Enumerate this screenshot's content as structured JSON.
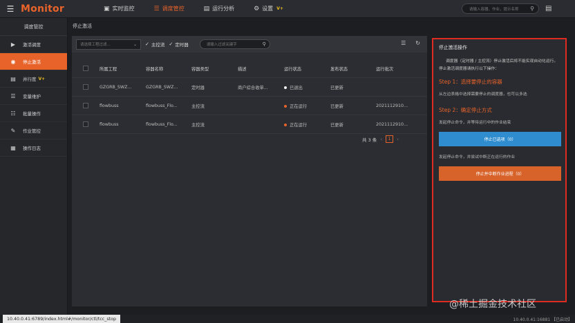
{
  "app": {
    "brand": "Monitor"
  },
  "topnav": [
    {
      "icon": "monitor-icon",
      "label": "实时监控",
      "active": false
    },
    {
      "icon": "schedule-icon",
      "label": "调度管控",
      "active": true
    },
    {
      "icon": "analysis-icon",
      "label": "运行分析",
      "active": false
    },
    {
      "icon": "gear-icon",
      "label": "设置",
      "badge": "V+",
      "active": false
    }
  ],
  "top_search": {
    "placeholder": "请输入容器，作业，提示名称"
  },
  "sidebar": {
    "header": "调度管控",
    "items": [
      {
        "icon": "play-icon",
        "label": "激活调度"
      },
      {
        "icon": "stop-icon",
        "label": "停止激活",
        "active": true
      },
      {
        "icon": "parallel-icon",
        "label": "并行度",
        "badge": "V+"
      },
      {
        "icon": "variable-icon",
        "label": "变量维护"
      },
      {
        "icon": "batch-icon",
        "label": "批量操作"
      },
      {
        "icon": "job-icon",
        "label": "作业管控"
      },
      {
        "icon": "log-icon",
        "label": "操作日志"
      }
    ]
  },
  "breadcrumb": "停止激活",
  "filters": {
    "project_placeholder": "请选择工程过滤...",
    "main_flow_label": "主控流",
    "timer_label": "定时器",
    "search_placeholder": "请输入过滤关键字"
  },
  "table": {
    "headers": [
      "所属工程",
      "容器名称",
      "容器类型",
      "描述",
      "运行状态",
      "发布状态",
      "运行批次"
    ],
    "rows": [
      {
        "project": "GZGRB_SWZ...",
        "container": "GZGRB_SWZ...",
        "type": "定时器",
        "desc": "商户综合收单...",
        "status": "已退出",
        "status_color": "#f2f2f2",
        "publish": "已更新",
        "batch": ""
      },
      {
        "project": "flowbuss",
        "container": "flowbuss_Flo...",
        "type": "主控流",
        "desc": "",
        "status": "正在运行",
        "status_color": "#e8632a",
        "publish": "已更新",
        "batch": "2021112910..."
      },
      {
        "project": "flowbuss",
        "container": "flowbuss_Flo...",
        "type": "主控流",
        "desc": "",
        "status": "正在运行",
        "status_color": "#e8632a",
        "publish": "已更新",
        "batch": "2021112910..."
      }
    ]
  },
  "pagination": {
    "total_text": "共 3 条",
    "current_page": "1"
  },
  "right_panel": {
    "title": "停止激活操作",
    "description": "调度器（定时器 / 主控流）停止激活后将不能实现自动化运行。停止激活调度器请执行以下操作：",
    "step1_title": "Step 1：选择要停止的容器",
    "step1_desc": "从左边表格中选择需要停止的调度器，也可以多选",
    "step2_title": "Step 2：确定停止方式",
    "step2_desc1": "发起停止命令，并等待运行中的作业结束",
    "btn1": "停止已选项（0）",
    "step2_desc2": "发起停止命令，并尝试中断正在运行的作业",
    "btn2": "停止并中断作业进程（0）"
  },
  "statusbar": {
    "url": "10.40.0.41:6789/index.html#/monitor/ctl/tcc_stop",
    "right": "10.40.0.41:16881 【已启动】"
  },
  "watermark": "@稀土掘金技术社区"
}
